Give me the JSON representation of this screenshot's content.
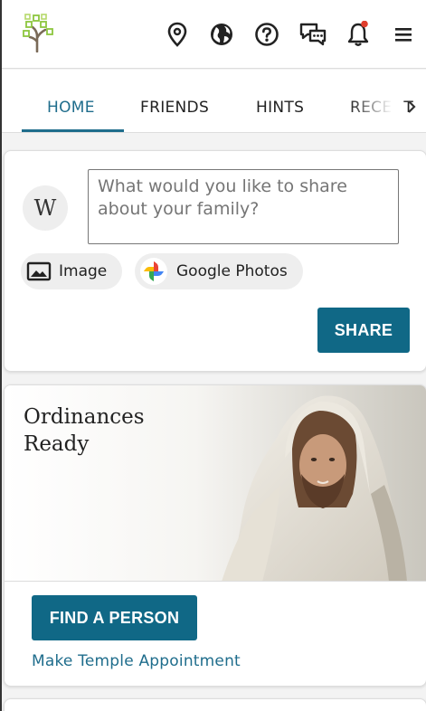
{
  "header": {
    "logo_icon": "family-tree-logo",
    "icons": [
      "map-pin-icon",
      "globe-icon",
      "help-icon",
      "messages-icon",
      "bell-icon",
      "menu-icon"
    ],
    "notification_dot_color": "#e03e2d"
  },
  "tabs": {
    "items": [
      {
        "label": "HOME",
        "active": true
      },
      {
        "label": "FRIENDS",
        "active": false
      },
      {
        "label": "HINTS",
        "active": false
      },
      {
        "label": "RECENT",
        "active": false
      }
    ],
    "accent": "#1f6d8c"
  },
  "post": {
    "avatar_initial": "W",
    "placeholder": "What would you like to share about your family?",
    "image_label": "Image",
    "google_photos_label": "Google Photos",
    "share_label": "SHARE"
  },
  "ordinances": {
    "title": "Ordinances Ready",
    "find_button": "FIND A PERSON",
    "temple_link": "Make Temple Appointment"
  },
  "colors": {
    "primary_button": "#106886",
    "link": "#1f6d8c"
  }
}
